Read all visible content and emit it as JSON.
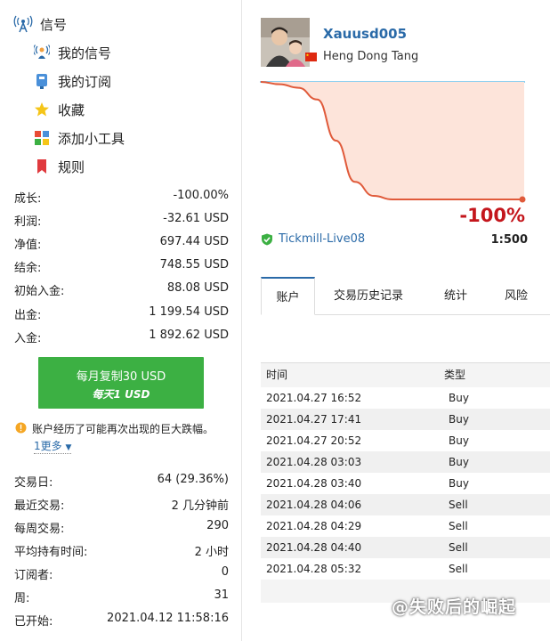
{
  "nav": {
    "header": "信号",
    "items": [
      {
        "label": "我的信号",
        "icon": "antenna-person-icon"
      },
      {
        "label": "我的订阅",
        "icon": "subscription-icon"
      },
      {
        "label": "收藏",
        "icon": "star-icon"
      },
      {
        "label": "添加小工具",
        "icon": "widget-icon"
      },
      {
        "label": "规则",
        "icon": "bookmark-icon"
      }
    ]
  },
  "stats_top": [
    {
      "key": "成长:",
      "value": "-100.00%"
    },
    {
      "key": "利润:",
      "value": "-32.61 USD"
    },
    {
      "key": "净值:",
      "value": "697.44 USD"
    },
    {
      "key": "结余:",
      "value": "748.55 USD"
    },
    {
      "key": "初始入金:",
      "value": "88.08 USD"
    },
    {
      "key": "出金:",
      "value": "1 199.54 USD"
    },
    {
      "key": "入金:",
      "value": "1 892.62 USD"
    }
  ],
  "subscribe": {
    "line1": "每月复制30 USD",
    "line2": "每天1 USD",
    "color": "#3cb043"
  },
  "warning": {
    "text": "账户经历了可能再次出现的巨大跌幅。",
    "more": "1更多"
  },
  "stats_bottom": [
    {
      "key": "交易日:",
      "value": "64 (29.36%)"
    },
    {
      "key": "最近交易:",
      "value": "2 几分钟前"
    },
    {
      "key": "每周交易:",
      "value": "290"
    },
    {
      "key": "平均持有时间:",
      "value": "2 小时"
    },
    {
      "key": "订阅者:",
      "value": "0"
    },
    {
      "key": "周:",
      "value": "31"
    },
    {
      "key": "已开始:",
      "value": "2021.04.12 11:58:16"
    }
  ],
  "signal": {
    "name": "Xauusd005",
    "author": "Heng Dong Tang",
    "growth": "-100%",
    "broker": "Tickmill-Live08",
    "leverage": "1:500"
  },
  "chart_data": {
    "type": "area",
    "series": [
      {
        "values": [
          0,
          -2,
          -5,
          -15,
          -50,
          -85,
          -97,
          -100,
          -100,
          -100,
          -100,
          -100,
          -100,
          -100,
          -100
        ]
      }
    ],
    "ylim": [
      -100,
      0
    ],
    "grid": false,
    "colors": {
      "line": "#e05a3a",
      "fill": "#fde4da",
      "top_line": "#8fd0f0"
    }
  },
  "tabs": [
    {
      "label": "账户"
    },
    {
      "label": "交易历史记录"
    },
    {
      "label": "统计"
    },
    {
      "label": "风险"
    }
  ],
  "trades": {
    "headers": {
      "time": "时间",
      "type": "类型"
    },
    "rows": [
      {
        "time": "2021.04.27 16:52",
        "type": "Buy"
      },
      {
        "time": "2021.04.27 17:41",
        "type": "Buy"
      },
      {
        "time": "2021.04.27 20:52",
        "type": "Buy"
      },
      {
        "time": "2021.04.28 03:03",
        "type": "Buy"
      },
      {
        "time": "2021.04.28 03:40",
        "type": "Buy"
      },
      {
        "time": "2021.04.28 04:06",
        "type": "Sell"
      },
      {
        "time": "2021.04.28 04:29",
        "type": "Sell"
      },
      {
        "time": "2021.04.28 04:40",
        "type": "Sell"
      },
      {
        "time": "2021.04.28 05:32",
        "type": "Sell"
      }
    ]
  },
  "watermark": "@失败后的崛起"
}
